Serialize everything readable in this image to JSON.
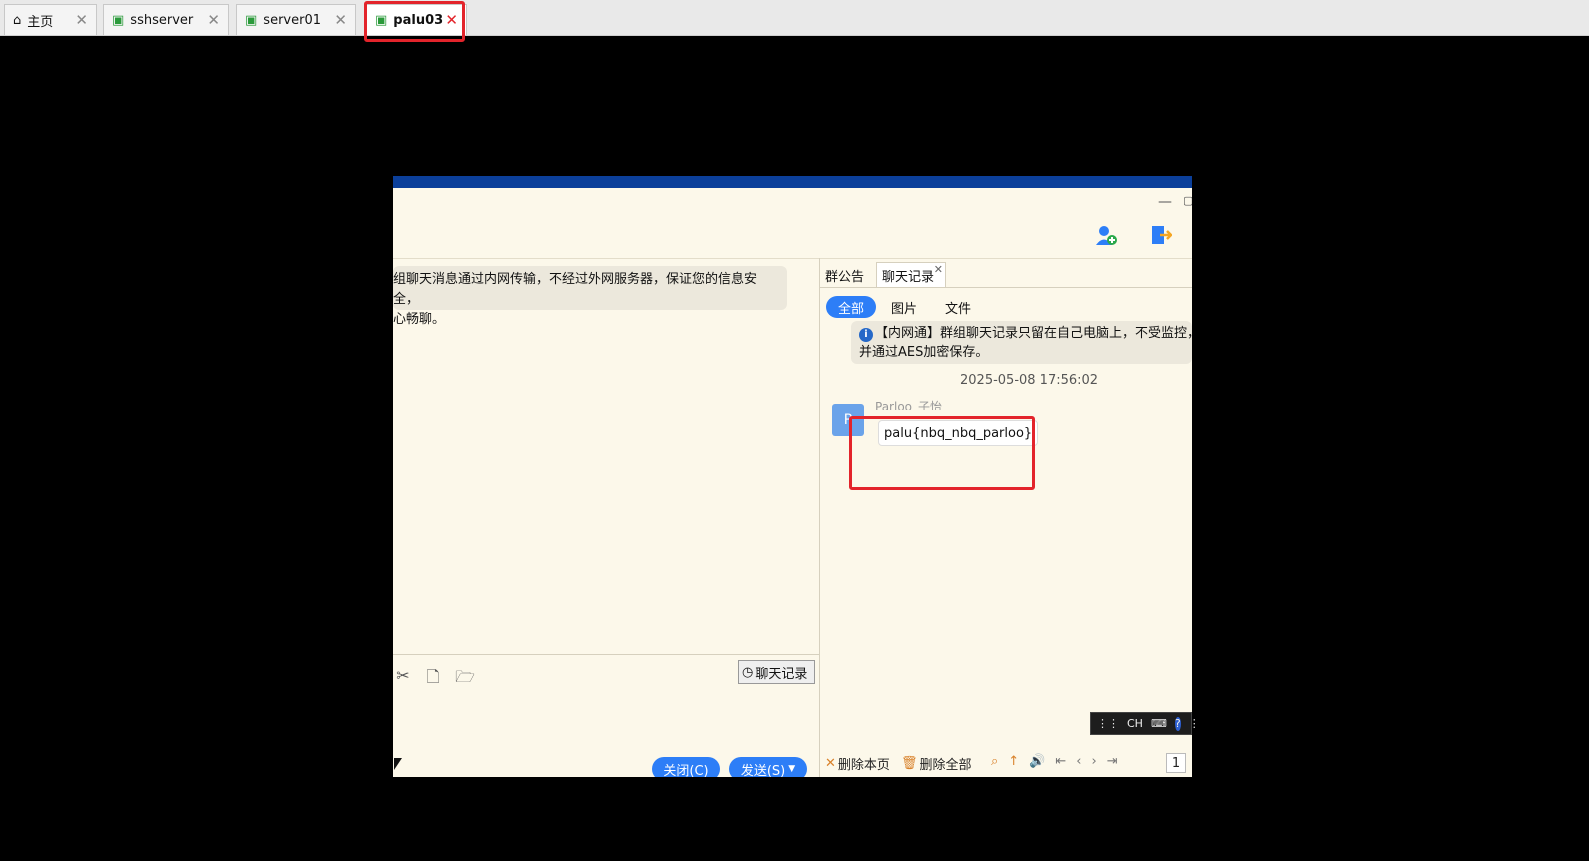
{
  "tabs": [
    {
      "label": "主页",
      "icon": "home-icon"
    },
    {
      "label": "sshserver",
      "icon": "vm-icon"
    },
    {
      "label": "server01",
      "icon": "vm-icon"
    },
    {
      "label": "palu03",
      "icon": "vm-icon",
      "active": true
    }
  ],
  "chat": {
    "system_message": "组聊天消息通过内网传输，不经过外网服务器，保证您的信息安全，\n心畅聊。",
    "history_button": "聊天记录",
    "close_button": "关闭(C)",
    "send_button": "发送(S)"
  },
  "right_panel": {
    "tabs": [
      "群公告",
      "聊天记录"
    ],
    "filters": [
      "全部",
      "图片",
      "文件"
    ],
    "notice_line1": "【内网通】群组聊天记录只留在自己电脑上，不受监控，",
    "notice_line2": "并通过AES加密保存。",
    "timestamp": "2025-05-08 17:56:02",
    "sender": "Parloo_子怡",
    "avatar_letter": "P",
    "message": "palu{nbq_nbq_parloo}",
    "delete_page": "删除本页",
    "delete_all": "删除全部",
    "page_number": "1"
  },
  "ime": {
    "label": "CH"
  },
  "colors": {
    "accent": "#2d7ef7",
    "highlight": "#e3242b",
    "titlebar": "#0b3f9a"
  }
}
